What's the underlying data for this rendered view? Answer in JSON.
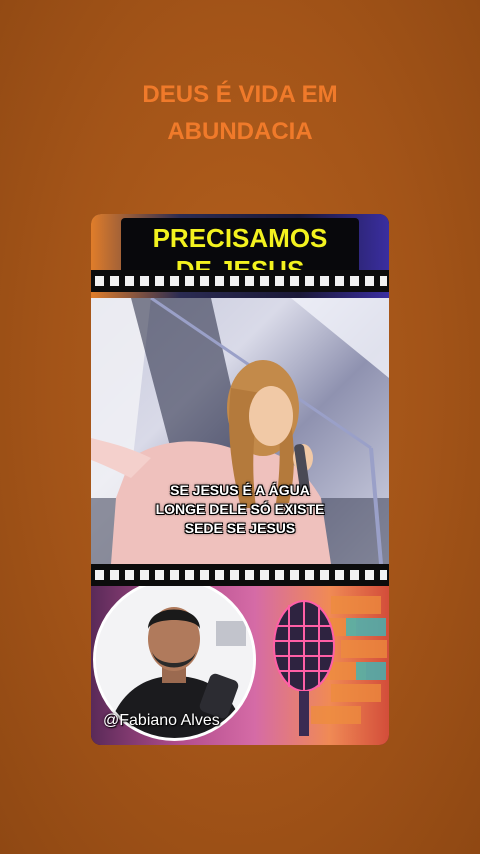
{
  "story": {
    "title_line1": "DEUS É VIDA EM",
    "title_line2": "ABUNDACIA"
  },
  "banner": {
    "line1": "PRECISAMOS",
    "line2": "DE JESUS"
  },
  "video": {
    "subtitle_line1": "SE JESUS É A ÁGUA",
    "subtitle_line2": "LONGE DELE SÓ EXISTE",
    "subtitle_line3": "SEDE SE JESUS"
  },
  "creator": {
    "handle": "@Fabiano Alves"
  },
  "colors": {
    "background": "#a35418",
    "title": "#f07a2a",
    "headline": "#f3f21f"
  },
  "icons": {
    "microphone": "microphone-icon"
  }
}
